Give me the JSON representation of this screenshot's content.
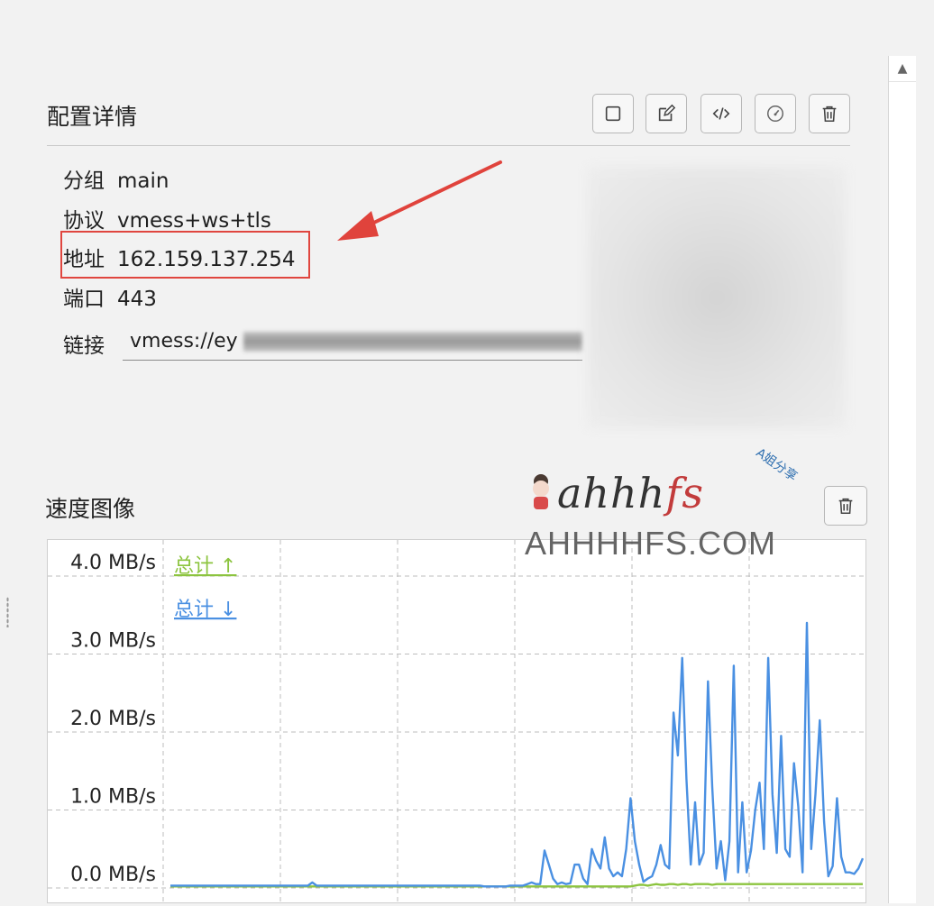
{
  "details": {
    "title": "配置详情",
    "toolbar": [
      {
        "name": "select-button",
        "icon": "square-icon"
      },
      {
        "name": "edit-button",
        "icon": "edit-icon"
      },
      {
        "name": "code-button",
        "icon": "code-icon"
      },
      {
        "name": "speedtest-button",
        "icon": "speedometer-icon"
      },
      {
        "name": "delete-button",
        "icon": "trash-icon"
      }
    ],
    "fields": {
      "group": {
        "label": "分组",
        "value": "main"
      },
      "protocol": {
        "label": "协议",
        "value": "vmess+ws+tls"
      },
      "address": {
        "label": "地址",
        "value": "162.159.137.254"
      },
      "port": {
        "label": "端口",
        "value": "443"
      },
      "link": {
        "label": "链接",
        "value": "vmess://ey"
      }
    }
  },
  "speed": {
    "title": "速度图像",
    "clear_icon": "trash-icon"
  },
  "chart_data": {
    "type": "line",
    "yticks": [
      "0.0 MB/s",
      "1.0 MB/s",
      "2.0 MB/s",
      "3.0 MB/s",
      "4.0 MB/s"
    ],
    "ylim": [
      0,
      4.0
    ],
    "xlim": [
      0,
      160
    ],
    "grid": true,
    "legend_position": "top-left",
    "series": [
      {
        "name": "总计 ↑",
        "color": "#8cc43f",
        "values": [
          0.02,
          0.02,
          0.02,
          0.02,
          0.02,
          0.02,
          0.02,
          0.02,
          0.02,
          0.02,
          0.02,
          0.02,
          0.02,
          0.02,
          0.02,
          0.02,
          0.02,
          0.02,
          0.02,
          0.02,
          0.02,
          0.02,
          0.02,
          0.02,
          0.02,
          0.02,
          0.02,
          0.02,
          0.02,
          0.02,
          0.02,
          0.02,
          0.02,
          0.02,
          0.02,
          0.02,
          0.02,
          0.02,
          0.02,
          0.02,
          0.02,
          0.02,
          0.02,
          0.02,
          0.02,
          0.02,
          0.02,
          0.02,
          0.02,
          0.02,
          0.02,
          0.02,
          0.02,
          0.02,
          0.02,
          0.02,
          0.02,
          0.02,
          0.02,
          0.02,
          0.02,
          0.02,
          0.02,
          0.02,
          0.02,
          0.02,
          0.02,
          0.02,
          0.02,
          0.02,
          0.02,
          0.02,
          0.02,
          0.02,
          0.02,
          0.02,
          0.02,
          0.02,
          0.02,
          0.02,
          0.02,
          0.02,
          0.02,
          0.02,
          0.02,
          0.02,
          0.02,
          0.02,
          0.02,
          0.02,
          0.02,
          0.02,
          0.02,
          0.02,
          0.02,
          0.02,
          0.02,
          0.02,
          0.02,
          0.02,
          0.02,
          0.02,
          0.02,
          0.02,
          0.02,
          0.02,
          0.02,
          0.02,
          0.03,
          0.04,
          0.04,
          0.03,
          0.04,
          0.05,
          0.04,
          0.04,
          0.05,
          0.05,
          0.04,
          0.05,
          0.05,
          0.04,
          0.05,
          0.05,
          0.05,
          0.05,
          0.04,
          0.05,
          0.05,
          0.05,
          0.05,
          0.05,
          0.05,
          0.05,
          0.05,
          0.05,
          0.05,
          0.05,
          0.05,
          0.05,
          0.05,
          0.05,
          0.05,
          0.05,
          0.05,
          0.05,
          0.05,
          0.05,
          0.05,
          0.05,
          0.05,
          0.05,
          0.05,
          0.05,
          0.05,
          0.05,
          0.05,
          0.05,
          0.05,
          0.05,
          0.05,
          0.05
        ]
      },
      {
        "name": "总计 ↓",
        "color": "#4a90e2",
        "values": [
          0.03,
          0.03,
          0.03,
          0.03,
          0.03,
          0.03,
          0.03,
          0.03,
          0.03,
          0.03,
          0.03,
          0.03,
          0.03,
          0.03,
          0.03,
          0.03,
          0.03,
          0.03,
          0.03,
          0.03,
          0.03,
          0.03,
          0.03,
          0.03,
          0.03,
          0.03,
          0.03,
          0.03,
          0.03,
          0.03,
          0.03,
          0.03,
          0.03,
          0.07,
          0.03,
          0.03,
          0.03,
          0.03,
          0.03,
          0.03,
          0.03,
          0.03,
          0.03,
          0.03,
          0.03,
          0.03,
          0.03,
          0.03,
          0.03,
          0.03,
          0.03,
          0.03,
          0.03,
          0.03,
          0.03,
          0.03,
          0.03,
          0.03,
          0.03,
          0.03,
          0.03,
          0.03,
          0.03,
          0.03,
          0.03,
          0.03,
          0.03,
          0.03,
          0.03,
          0.03,
          0.03,
          0.03,
          0.03,
          0.02,
          0.02,
          0.02,
          0.02,
          0.02,
          0.02,
          0.03,
          0.03,
          0.03,
          0.03,
          0.05,
          0.07,
          0.05,
          0.05,
          0.48,
          0.3,
          0.12,
          0.05,
          0.07,
          0.05,
          0.06,
          0.3,
          0.3,
          0.12,
          0.05,
          0.5,
          0.35,
          0.25,
          0.65,
          0.25,
          0.15,
          0.2,
          0.15,
          0.5,
          1.15,
          0.6,
          0.3,
          0.08,
          0.12,
          0.15,
          0.3,
          0.55,
          0.3,
          0.25,
          2.25,
          1.7,
          2.95,
          1.4,
          0.3,
          1.1,
          0.3,
          0.45,
          2.65,
          1.3,
          0.25,
          0.6,
          0.1,
          0.6,
          2.85,
          0.2,
          1.1,
          0.2,
          0.48,
          1.0,
          1.35,
          0.5,
          2.95,
          1.2,
          0.45,
          1.95,
          0.5,
          0.4,
          1.6,
          1.05,
          0.2,
          3.4,
          0.5,
          1.2,
          2.15,
          0.85,
          0.15,
          0.28,
          1.15,
          0.4,
          0.2,
          0.2,
          0.18,
          0.25,
          0.38
        ]
      }
    ]
  }
}
